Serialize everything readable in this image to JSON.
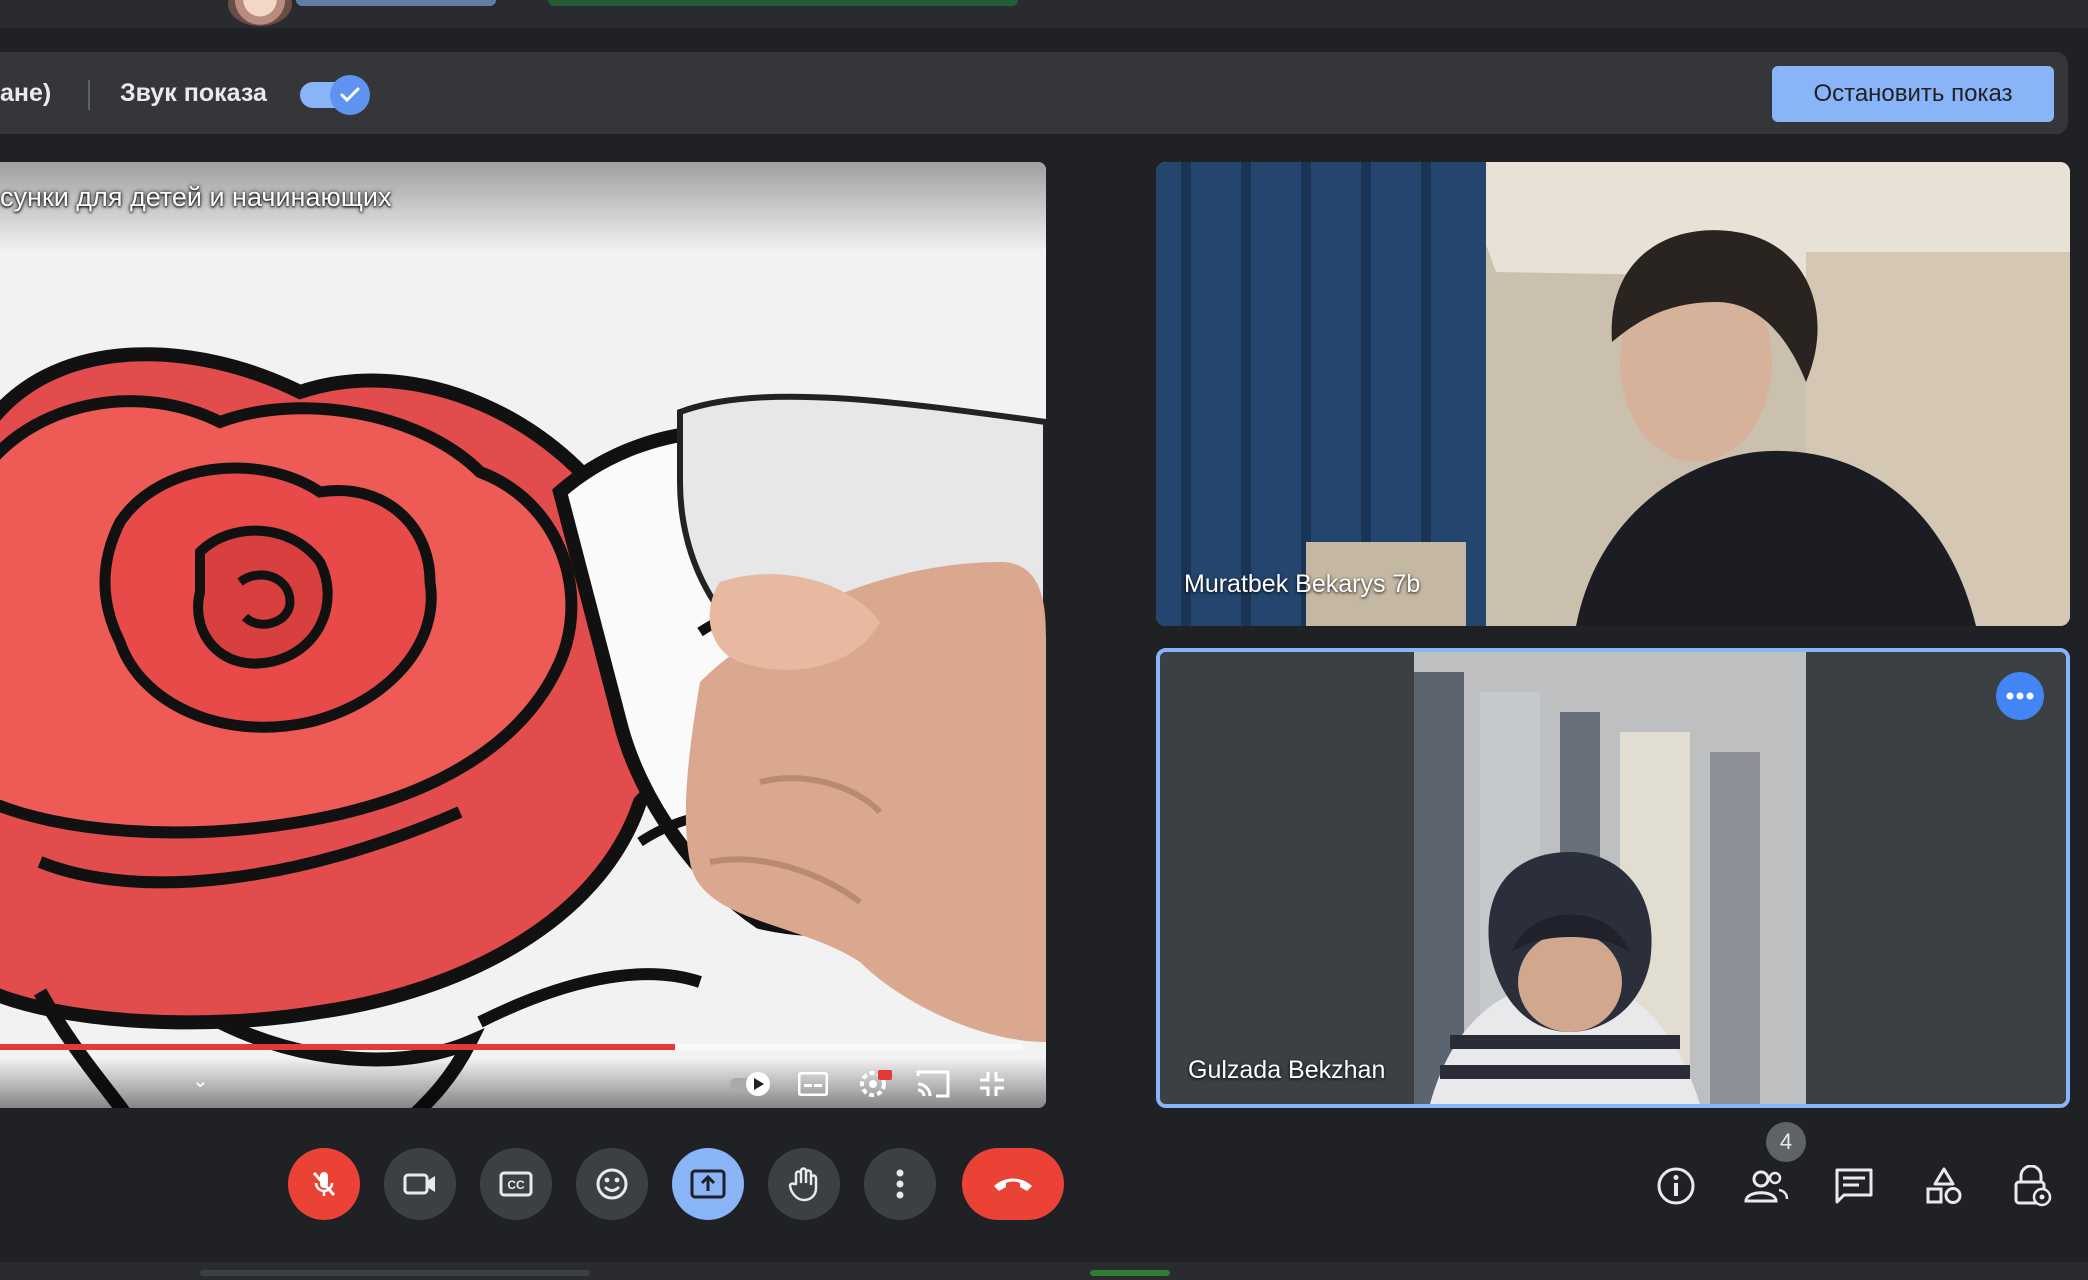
{
  "share_bar": {
    "presenting_label_fragment": "ане)",
    "sound_label": "Звук показа",
    "sound_toggle_on": true,
    "stop_button_label": "Остановить показ"
  },
  "shared_video": {
    "title_fragment": "сунки для детей и начинающих",
    "progress_fraction": 0.66
  },
  "participants": [
    {
      "name": "Muratbek Bekarys 7b"
    },
    {
      "name": "Gulzada Bekzhan"
    }
  ],
  "controls": {
    "participants_count": "4",
    "icons": [
      "mic-off-icon",
      "camera-icon",
      "captions-icon",
      "emoji-icon",
      "present-icon",
      "raise-hand-icon",
      "more-options-icon",
      "hang-up-icon",
      "info-icon",
      "people-icon",
      "chat-icon",
      "activities-icon",
      "host-controls-icon"
    ]
  },
  "colors": {
    "accent_blue": "#8ab4f8",
    "hangup_red": "#ea4335",
    "background": "#202124",
    "progress_red": "#e53935"
  }
}
